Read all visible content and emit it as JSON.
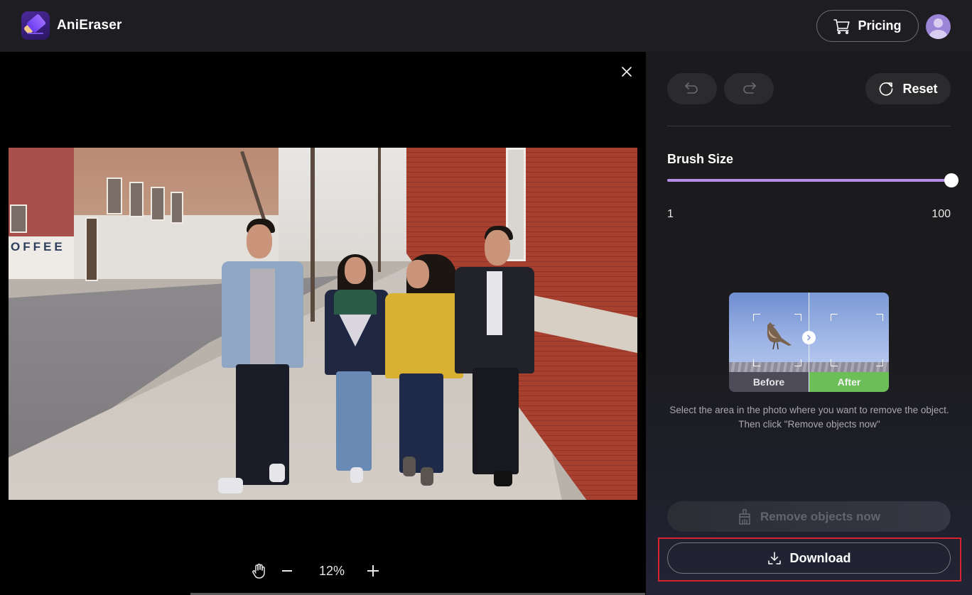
{
  "app": {
    "title": "AniEraser",
    "logo_icon": "eraser-logo-icon"
  },
  "header": {
    "pricing_label": "Pricing",
    "pricing_icon": "cart-icon",
    "avatar_icon": "user-avatar-icon"
  },
  "canvas": {
    "close_icon": "close-icon",
    "image_description": "Four friends walking on a city sidewalk next to a red brick building",
    "zoom": {
      "hand_icon": "hand-pan-icon",
      "minus_icon": "zoom-out-icon",
      "value": "12%",
      "plus_icon": "zoom-in-icon"
    }
  },
  "panel": {
    "undo_icon": "undo-icon",
    "redo_icon": "redo-icon",
    "reset_label": "Reset",
    "reset_icon": "reset-icon",
    "brush": {
      "title": "Brush Size",
      "min_label": "1",
      "max_label": "100",
      "min": 1,
      "max": 100,
      "value": 100,
      "accent_color": "#b68ce9"
    },
    "demo": {
      "before_label": "Before",
      "after_label": "After",
      "after_color": "#6cbf58",
      "arrow_icon": "chevron-right-icon"
    },
    "hint": "Select the area in the photo where you want to remove the object. Then click \"Remove objects now\"",
    "remove_label": "Remove objects now",
    "remove_icon": "brush-broom-icon",
    "download_label": "Download",
    "download_icon": "download-icon",
    "highlight_color": "#d6232c"
  }
}
